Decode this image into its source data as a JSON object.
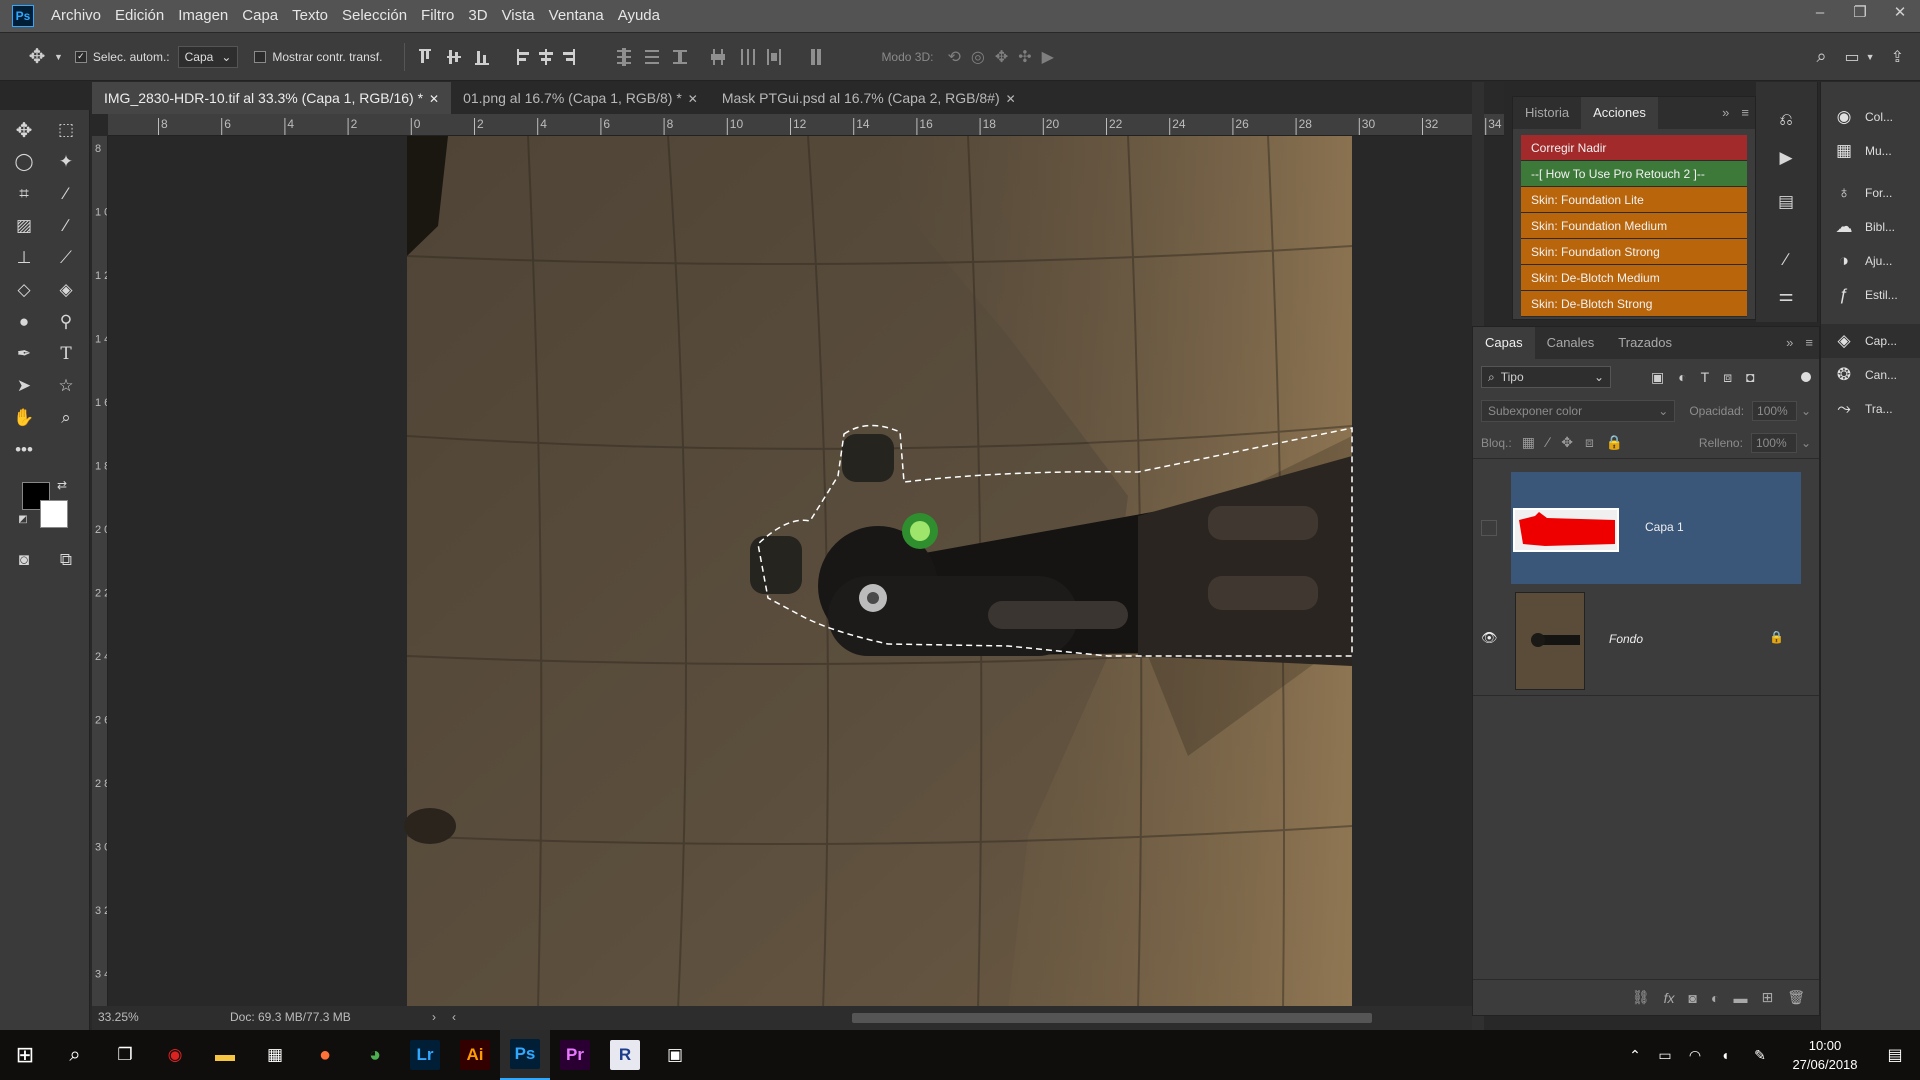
{
  "menubar": {
    "logo": "Ps",
    "items": [
      "Archivo",
      "Edición",
      "Imagen",
      "Capa",
      "Texto",
      "Selección",
      "Filtro",
      "3D",
      "Vista",
      "Ventana",
      "Ayuda"
    ],
    "window_controls": [
      "–",
      "❐",
      "✕"
    ]
  },
  "options": {
    "auto_select_label": "Selec. autom.:",
    "auto_select_value": "Capa",
    "show_transform_label": "Mostrar contr. transf.",
    "mode3d_label": "Modo 3D:"
  },
  "tabs": [
    {
      "label": "IMG_2830-HDR-10.tif al 33.3% (Capa 1, RGB/16) *",
      "active": true
    },
    {
      "label": "01.png al 16.7% (Capa 1, RGB/8) *",
      "active": false
    },
    {
      "label": "Mask PTGui.psd al 16.7% (Capa 2, RGB/8#)",
      "active": false
    }
  ],
  "ruler": {
    "top_labels": [
      "8",
      "6",
      "4",
      "2",
      "0",
      "2",
      "4",
      "6",
      "8",
      "10",
      "12",
      "14",
      "16",
      "18",
      "20",
      "22",
      "24",
      "26",
      "28",
      "30",
      "32",
      "34"
    ],
    "left_labels": [
      "8",
      "1 0",
      "1 2",
      "1 4",
      "1 6",
      "1 8",
      "2 0",
      "2 2",
      "2 4",
      "2 6",
      "2 8",
      "3 0",
      "3 2",
      "3 4"
    ]
  },
  "status": {
    "zoom": "33.25%",
    "doc": "Doc: 69.3 MB/77.3 MB"
  },
  "actions_panel": {
    "tabs": [
      "Historia",
      "Acciones"
    ],
    "items": [
      {
        "label": "Corregir Nadir",
        "color": "#a32a2a"
      },
      {
        "label": "--[ How To Use Pro Retouch 2 ]--",
        "color": "#3d7a3a"
      },
      {
        "label": "Skin: Foundation Lite",
        "color": "#b9650b"
      },
      {
        "label": "Skin: Foundation Medium",
        "color": "#b9650b"
      },
      {
        "label": "Skin: Foundation Strong",
        "color": "#b9650b"
      },
      {
        "label": "Skin: De-Blotch Medium",
        "color": "#b9650b"
      },
      {
        "label": "Skin: De-Blotch Strong",
        "color": "#b9650b"
      }
    ]
  },
  "layers_panel": {
    "tabs": [
      "Capas",
      "Canales",
      "Trazados"
    ],
    "filter_label": "Tipo",
    "blend_mode": "Subexponer color",
    "opacity_label": "Opacidad:",
    "opacity_value": "100%",
    "lock_label": "Bloq.:",
    "fill_label": "Relleno:",
    "fill_value": "100%",
    "layers": [
      {
        "name": "Capa 1",
        "visible": false,
        "selected": true
      },
      {
        "name": "Fondo",
        "visible": true,
        "selected": false,
        "locked": true
      }
    ]
  },
  "side_panels": [
    {
      "icon": "color-icon",
      "label": "Col..."
    },
    {
      "icon": "swatches-icon",
      "label": "Mu..."
    },
    {
      "icon": "learn-icon",
      "label": "For..."
    },
    {
      "icon": "libraries-icon",
      "label": "Bibl..."
    },
    {
      "icon": "adjustments-icon",
      "label": "Aju..."
    },
    {
      "icon": "styles-icon",
      "label": "Estil..."
    },
    {
      "icon": "layers-icon",
      "label": "Cap..."
    },
    {
      "icon": "channels-icon",
      "label": "Can..."
    },
    {
      "icon": "paths-icon",
      "label": "Tra..."
    }
  ],
  "taskbar": {
    "apps": [
      "Lr",
      "Ai",
      "Ps",
      "Pr",
      "R"
    ],
    "time": "10:00",
    "date": "27/06/2018"
  },
  "colors": {
    "accent": "#31a8ff",
    "selected_layer": "#3a5679"
  }
}
